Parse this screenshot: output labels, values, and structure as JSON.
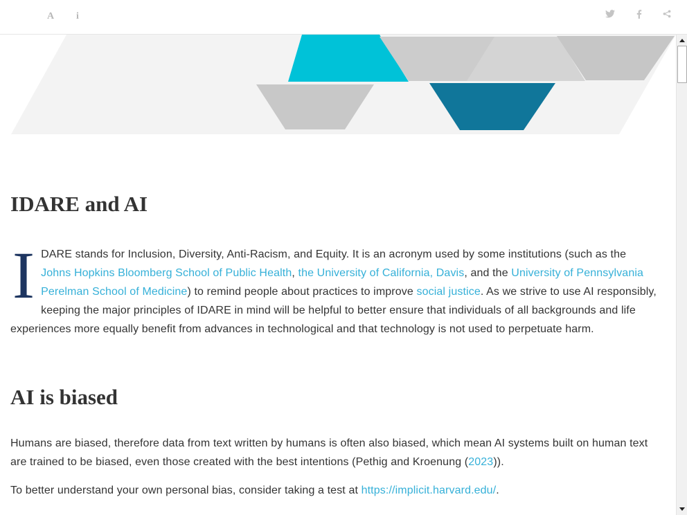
{
  "toolbar": {
    "font_icon": "A",
    "info_icon": "i"
  },
  "colors": {
    "accent_link": "#35b0d8",
    "dropcap": "#1d3560",
    "banner_cyan": "#00c2d8",
    "banner_teal": "#10769a",
    "banner_gray": "#c8c8c8",
    "banner_light": "#f3f3f3"
  },
  "section1": {
    "heading": "IDARE and AI",
    "dropcap": "I",
    "text_1": "DARE stands for Inclusion, Diversity, Anti-Racism, and Equity. It is an acronym used by some institutions (such as the ",
    "link_jhu": "Johns Hopkins Bloomberg School of Public Health",
    "text_2": ", ",
    "link_ucd": "the University of California, Davis",
    "text_3": ", and the ",
    "link_penn": "University of Pennsylvania Perelman School of Medicine",
    "text_4": ") to remind people about practices to improve ",
    "link_social": "social justice",
    "text_5": ". As we strive to use AI responsibly, keeping the major principles of IDARE in mind will be helpful to better ensure that individuals of all backgrounds and life experiences more equally benefit from advances in technological and that technology is not used to perpetuate harm."
  },
  "section2": {
    "heading": "AI is biased",
    "p1_text": "Humans are biased, therefore data from text written by humans is often also biased, which mean AI systems built on human text are trained to be biased, even those created with the best intentions (Pethig and Kroenung (",
    "p1_link": "2023",
    "p1_end": ")).",
    "p2_text": "To better understand your own personal bias, consider taking a test at ",
    "p2_link": "https://implicit.harvard.edu/",
    "p2_end": "."
  }
}
